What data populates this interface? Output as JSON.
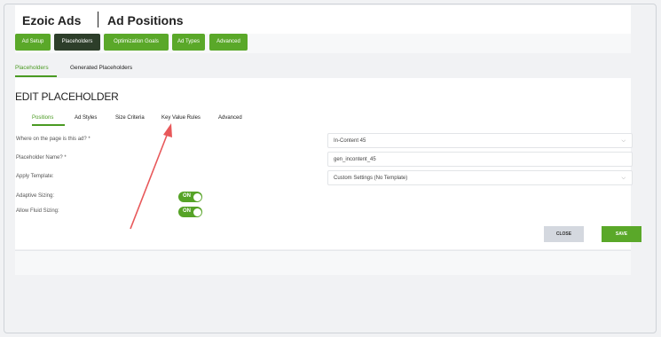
{
  "header": {
    "brand": "Ezoic Ads",
    "section": "Ad Positions"
  },
  "nav_buttons": [
    "Ad Setup",
    "Placeholders",
    "Optimization Goals",
    "Ad Types",
    "Advanced"
  ],
  "subtabs": [
    "Placeholders",
    "Generated Placeholders"
  ],
  "card": {
    "title": "EDIT PLACEHOLDER",
    "tabs": [
      "Positions",
      "Ad Styles",
      "Size Criteria",
      "Key Value Rules",
      "Advanced"
    ],
    "fields": {
      "position_label": "Where on the page is this ad? *",
      "position_value": "In-Content 45",
      "name_label": "Placeholder Name? *",
      "name_value": "gen_incontent_45",
      "template_label": "Apply Template:",
      "template_value": "Custom Settings (No Template)",
      "adaptive_label": "Adaptive Sizing:",
      "adaptive_state": "ON",
      "fluid_label": "Allow Fluid Sizing:",
      "fluid_state": "ON"
    },
    "close_label": "CLOSE",
    "save_label": "SAVE"
  },
  "icons": {
    "chevron": "chevron-down-icon"
  },
  "colors": {
    "accent_green": "#5aa829",
    "active_nav": "#2d3e2a",
    "annotation_arrow": "#e8585a"
  }
}
